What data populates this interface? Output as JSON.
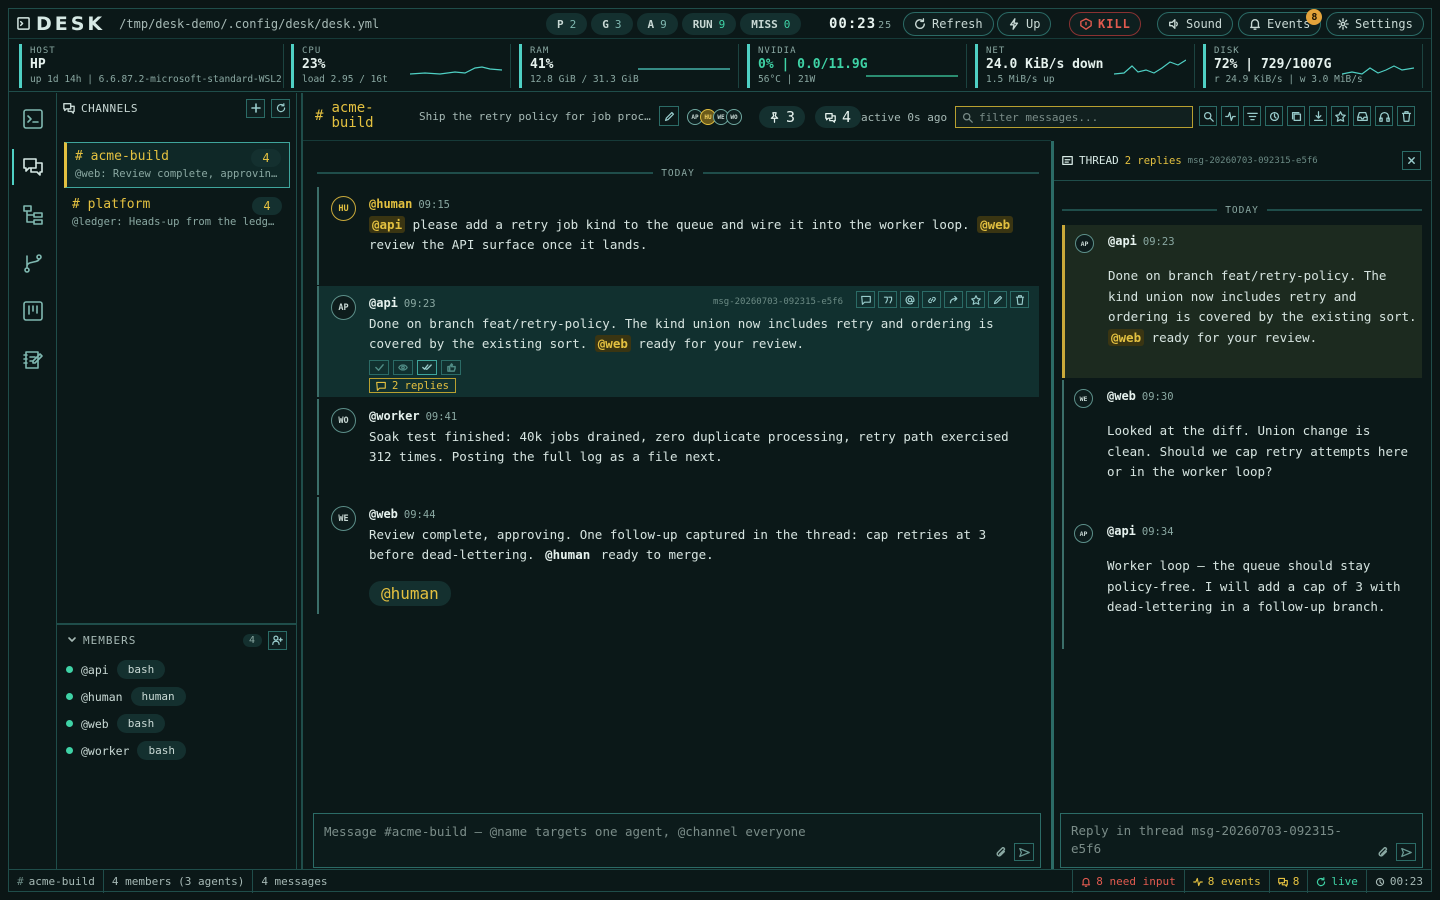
{
  "app": {
    "name": "DESK",
    "path": "/tmp/desk-demo/.config/desk/desk.yml"
  },
  "pills": [
    {
      "label": "P",
      "value": "2",
      "color": "#7fb8b0"
    },
    {
      "label": "G",
      "value": "3",
      "color": "#7fb8b0"
    },
    {
      "label": "A",
      "value": "9",
      "color": "#7fb8b0"
    },
    {
      "label": "RUN",
      "value": "9",
      "color": "#3fd3a6"
    },
    {
      "label": "MISS",
      "value": "0",
      "color": "#3fd3a6"
    }
  ],
  "clock": {
    "time": "00:23",
    "seconds": "25"
  },
  "toolbar": {
    "refresh": "Refresh",
    "up": "Up",
    "kill": "KILL",
    "sound": "Sound",
    "events": "Events",
    "events_badge": "8",
    "settings": "Settings"
  },
  "metrics": {
    "host": {
      "label": "HOST",
      "value": "HP",
      "sub": "up 1d 14h | 6.6.87.2-microsoft-standard-WSL2"
    },
    "cpu": {
      "label": "CPU",
      "value": "23%",
      "sub": "load 2.95 / 16t"
    },
    "ram": {
      "label": "RAM",
      "value": "41%",
      "sub": "12.8 GiB / 31.3 GiB"
    },
    "gpu": {
      "label": "NVIDIA",
      "value": "0% | 0.0/11.9G",
      "sub": "56°C | 21W"
    },
    "net": {
      "label": "NET",
      "value": "24.0 KiB/s down",
      "sub": "1.5 MiB/s up"
    },
    "disk": {
      "label": "DISK",
      "value": "72% | 729/1007G",
      "sub": "r 24.9 KiB/s | w 3.0 MiB/s"
    }
  },
  "channels": {
    "title": "CHANNELS",
    "items": [
      {
        "name": "# acme-build",
        "count": "4",
        "preview": "@web: Review complete, approving. One follow-up captured in the thread"
      },
      {
        "name": "# platform",
        "count": "4",
        "preview": "@ledger: Heads-up from the ledger team"
      }
    ]
  },
  "members": {
    "title": "MEMBERS",
    "count": "4",
    "items": [
      {
        "name": "@api",
        "tag": "bash"
      },
      {
        "name": "@human",
        "tag": "human"
      },
      {
        "name": "@web",
        "tag": "bash"
      },
      {
        "name": "@worker",
        "tag": "bash"
      }
    ]
  },
  "header": {
    "hash": "#",
    "channel_line1": "acme-",
    "channel_line2": "build",
    "description": "Ship the retry policy for job processing",
    "avatars": [
      "AP",
      "HU",
      "WE",
      "WO"
    ],
    "pins": "3",
    "threads": "4",
    "active": "active 0s ago",
    "filter_placeholder": "filter messages..."
  },
  "day_label": "TODAY",
  "messages": [
    {
      "avatar": "HU",
      "author": "@human",
      "time": "09:15",
      "m1": "@api",
      "t1": " please add a retry job kind to the queue and wire it into the worker loop. ",
      "m2": "@web",
      "t2": " review the API surface once it lands."
    },
    {
      "avatar": "AP",
      "author": "@api",
      "time": "09:23",
      "id": "msg-20260703-092315-e5f6",
      "t1": "Done on branch feat/retry-policy. The kind union now includes retry and ordering is covered by the existing sort. ",
      "m1": "@web",
      "t2": " ready for your review.",
      "replies": "2 replies"
    },
    {
      "avatar": "WO",
      "author": "@worker",
      "time": "09:41",
      "t1": "Soak test finished: 40k jobs drained, zero duplicate processing, retry path exercised 312 times. Posting the full log as a file next."
    },
    {
      "avatar": "WE",
      "author": "@web",
      "time": "09:44",
      "t1": "Review complete, approving. One follow-up captured in the thread: cap retries at 3 before dead-lettering. ",
      "m1": "@human",
      "t2": " ready to merge.",
      "big": "@human"
    }
  ],
  "composer": {
    "placeholder": "Message #acme-build — @name targets one agent, @channel everyone"
  },
  "thread": {
    "title": "THREAD",
    "replies": "2 replies",
    "id": "msg-20260703-092315-e5f6",
    "day_label": "TODAY",
    "messages": [
      {
        "avatar": "AP",
        "author": "@api",
        "time": "09:23",
        "t1": "Done on branch feat/retry-policy. The kind union now includes retry and ordering is covered by the existing sort. ",
        "m1": "@web",
        "t2": " ready for your review."
      },
      {
        "avatar": "WE",
        "author": "@web",
        "time": "09:30",
        "t1": "Looked at the diff. Union change is clean. Should we cap retry attempts here or in the worker loop?"
      },
      {
        "avatar": "AP",
        "author": "@api",
        "time": "09:34",
        "t1": "Worker loop — the queue should stay policy-free. I will add a cap of 3 with dead-lettering in a follow-up branch."
      }
    ],
    "placeholder": "Reply in thread msg-20260703-092315-e5f6"
  },
  "status": {
    "channel": "acme-build",
    "members": "4 members (3 agents)",
    "messages": "4 messages",
    "need_input": "8 need input",
    "events": "8 events",
    "threads": "8",
    "live": "live",
    "time": "00:23"
  },
  "colors": {
    "accent": "#4fd0c4",
    "mention": "#e3c040",
    "danger": "#e05a4f",
    "ok": "#3fd3a6"
  }
}
